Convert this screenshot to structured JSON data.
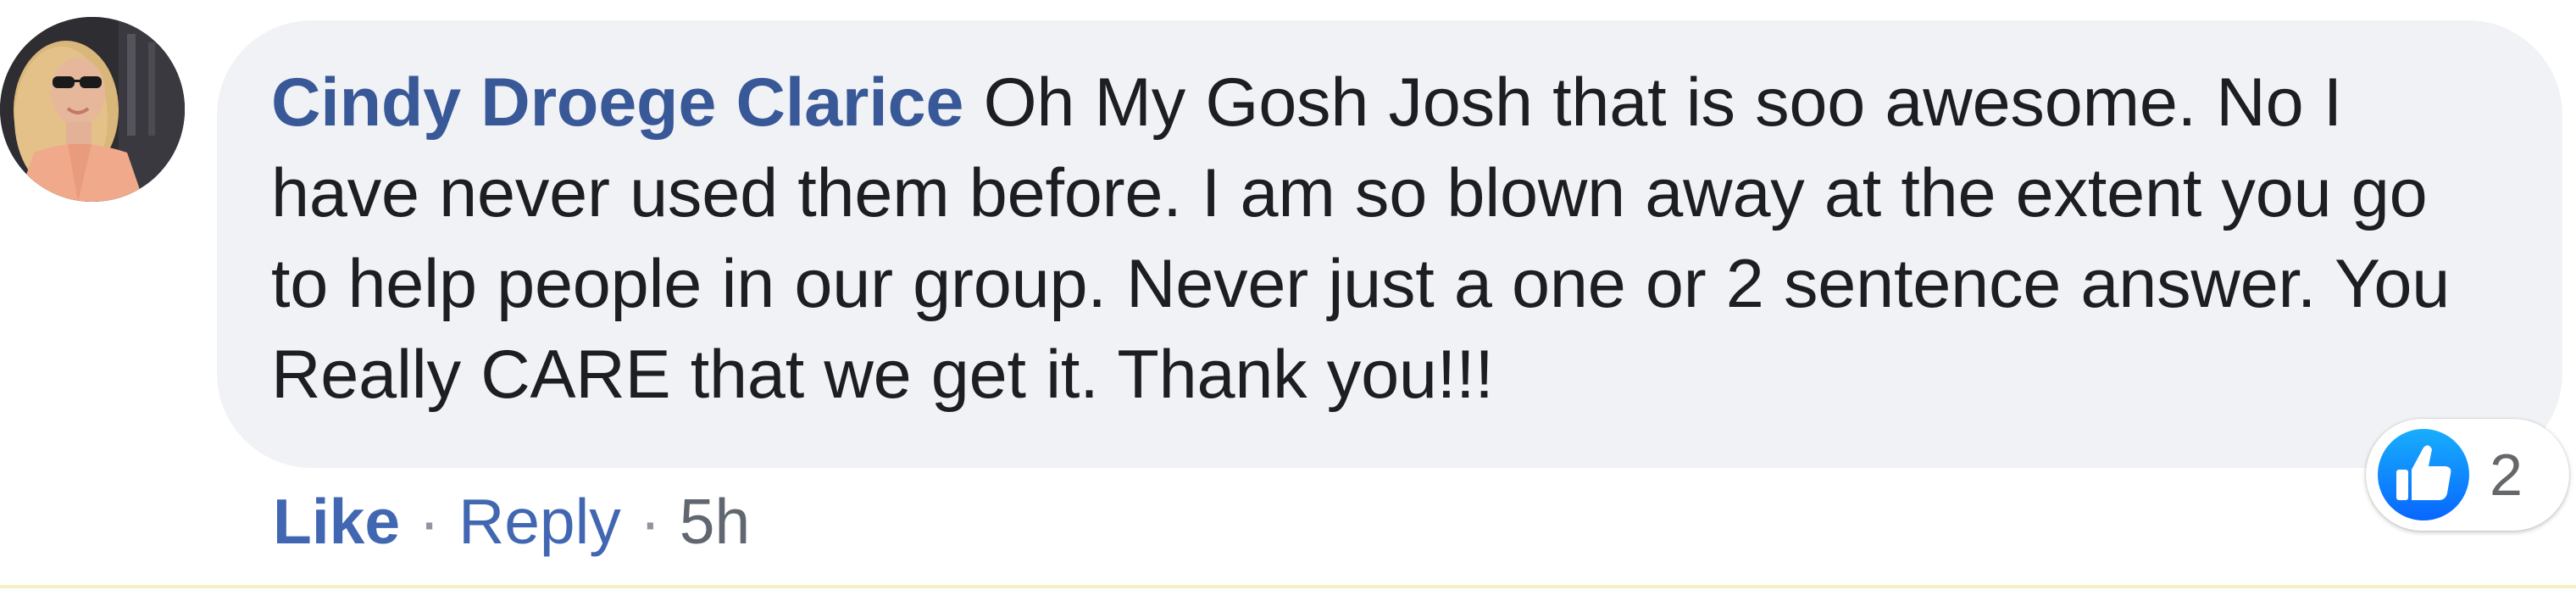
{
  "comment": {
    "author": "Cindy Droege Clarice",
    "text": " Oh My Gosh Josh that is soo awesome. No I have never used them before. I am so blown away at the extent you go to help people in our group. Never just a one or 2 sentence answer. You Really CARE that we get it. Thank you!!!",
    "avatar_icon": "user-avatar-photo"
  },
  "reactions": {
    "icon": "thumbs-up-icon",
    "count": "2",
    "color": "#1877f2"
  },
  "actions": {
    "like_label": "Like",
    "separator": "·",
    "reply_label": "Reply",
    "timestamp": "5h"
  },
  "colors": {
    "author_link": "#385898",
    "action_link": "#4267b2",
    "bubble_bg": "#f0f2f5",
    "text": "#1c1e21"
  }
}
